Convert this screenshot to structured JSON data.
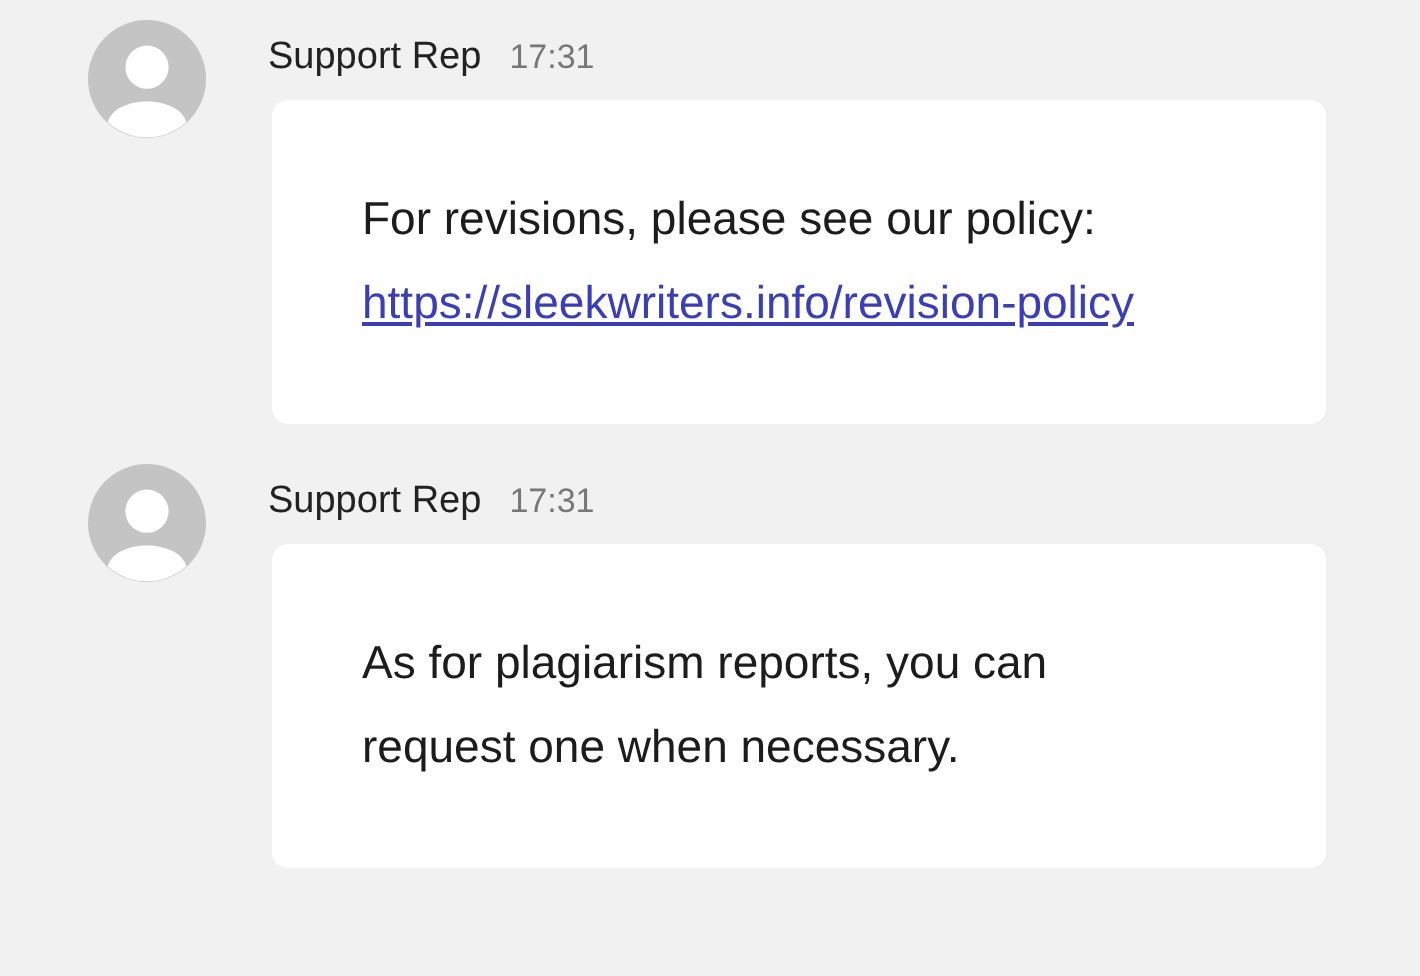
{
  "messages": [
    {
      "sender": "Support Rep",
      "time": "17:31",
      "parts": [
        {
          "kind": "text",
          "text": "For revisions, please see our policy:"
        },
        {
          "kind": "link",
          "text": "https://sleekwriters.info/revision-policy"
        }
      ]
    },
    {
      "sender": "Support Rep",
      "time": "17:31",
      "parts": [
        {
          "kind": "text",
          "text": "As for plagiarism reports, you can request one when necessary."
        }
      ]
    }
  ]
}
